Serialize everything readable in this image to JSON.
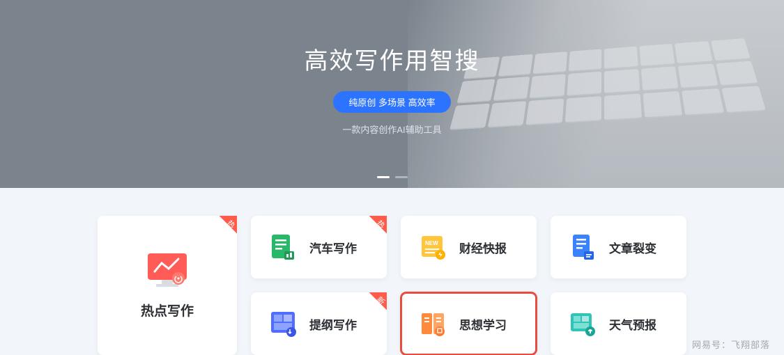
{
  "hero": {
    "title": "高效写作用智搜",
    "pill": "纯原创 多场景 高效率",
    "subtitle": "一款内容创作AI辅助工具"
  },
  "ribbons": {
    "hot": "热",
    "new": "新"
  },
  "main_card": {
    "label": "热点写作",
    "icon": "chart-monitor-icon",
    "ribbon": "hot"
  },
  "cards": [
    {
      "label": "汽车写作",
      "icon": "doc-green-icon",
      "ribbon": "hot",
      "highlight": false
    },
    {
      "label": "财经快报",
      "icon": "news-yellow-icon",
      "ribbon": null,
      "highlight": false
    },
    {
      "label": "文章裂变",
      "icon": "doc-blue-icon",
      "ribbon": null,
      "highlight": false
    },
    {
      "label": "提纲写作",
      "icon": "grid-blue-icon",
      "ribbon": "new",
      "highlight": false
    },
    {
      "label": "思想学习",
      "icon": "book-orange-icon",
      "ribbon": null,
      "highlight": true
    },
    {
      "label": "天气预报",
      "icon": "weather-teal-icon",
      "ribbon": null,
      "highlight": false
    }
  ],
  "watermark": "网易号：飞翔部落",
  "colors": {
    "accent": "#2c73ff",
    "ribbon": "#ff5b4a",
    "highlight_border": "#e74c3c"
  }
}
